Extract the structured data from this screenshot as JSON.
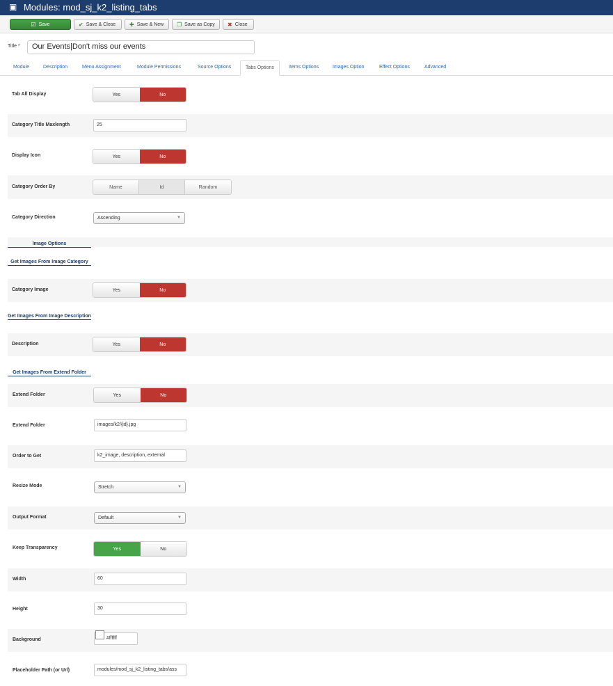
{
  "header": {
    "title": "Modules: mod_sj_k2_listing_tabs",
    "icon": "cube-icon"
  },
  "toolbar": {
    "save": "Save",
    "save_close": "Save & Close",
    "save_new": "Save & New",
    "save_copy": "Save as Copy",
    "close": "Close"
  },
  "title_field": {
    "label": "Title *",
    "value": "Our Events|Don't miss our events"
  },
  "tabs": [
    "Module",
    "Description",
    "Menu Assignment",
    "Module Permissions",
    "Source Options",
    "Tabs Options",
    "Items Options",
    "Images Option",
    "Effect Options",
    "Advanced"
  ],
  "active_tab": "Tabs Options",
  "toggle": {
    "yes": "Yes",
    "no": "No"
  },
  "fields": {
    "tab_all_display": {
      "label": "Tab All Display",
      "value": "No"
    },
    "category_title_maxlength": {
      "label": "Category Title Maxlength",
      "value": "25"
    },
    "display_icon": {
      "label": "Display Icon",
      "value": "No"
    },
    "category_order_by": {
      "label": "Category Order By",
      "options": [
        "Name",
        "Id",
        "Random"
      ],
      "value": "Id"
    },
    "category_direction": {
      "label": "Category Direction",
      "value": "Ascending"
    },
    "category_image": {
      "label": "Category Image",
      "value": "No"
    },
    "description": {
      "label": "Description",
      "value": "No"
    },
    "extend_folder_toggle": {
      "label": "Extend Folder",
      "value": "No"
    },
    "extend_folder_path": {
      "label": "Extend Folder",
      "value": "images/k2/{id}.jpg"
    },
    "order_to_get": {
      "label": "Order to Get",
      "value": "k2_image, description, external"
    },
    "resize_mode": {
      "label": "Resize Mode",
      "value": "Stretch"
    },
    "output_format": {
      "label": "Output Format",
      "value": "Default"
    },
    "keep_transparency": {
      "label": "Keep Transparency",
      "value": "Yes"
    },
    "width": {
      "label": "Width",
      "value": "60"
    },
    "height": {
      "label": "Height",
      "value": "30"
    },
    "background": {
      "label": "Background",
      "value": "#ffffff"
    },
    "placeholder_path": {
      "label": "Placeholder Path (or Url)",
      "value": "modules/mod_sj_k2_listing_tabs/ass"
    }
  },
  "sections": {
    "image_options": "Image Options",
    "from_image_category": "Get Images From Image Category",
    "from_image_description": "Get Images From Image Description",
    "from_extend_folder": "Get Images From Extend Folder"
  },
  "colors": {
    "header_bg": "#1c3d6e",
    "save_green": "#46a546",
    "no_red": "#bd362f",
    "link_blue": "#2a69b8"
  }
}
